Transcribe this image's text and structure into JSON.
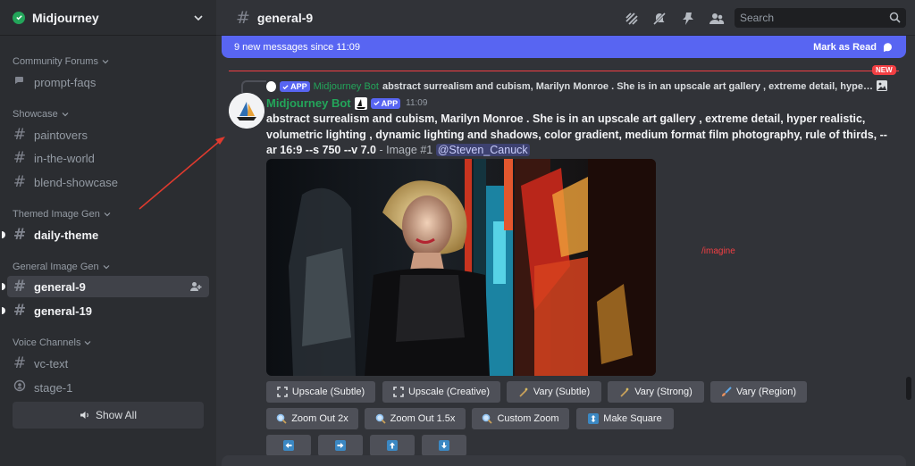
{
  "server": {
    "name": "Midjourney",
    "status_color": "#23a55a"
  },
  "sidebar": {
    "categories": [
      {
        "label": "Community Forums"
      },
      {
        "label": "Showcase"
      },
      {
        "label": "Themed Image Gen"
      },
      {
        "label": "General Image Gen"
      },
      {
        "label": "Voice Channels"
      }
    ],
    "channels": [
      {
        "label": "prompt-faqs",
        "icon": "forum-icon"
      },
      {
        "label": "paintovers",
        "icon": "hash-icon"
      },
      {
        "label": "in-the-world",
        "icon": "hash-icon"
      },
      {
        "label": "blend-showcase",
        "icon": "hash-icon"
      },
      {
        "label": "daily-theme",
        "icon": "hash-icon",
        "unread": true
      },
      {
        "label": "general-9",
        "icon": "hash-icon",
        "active": true
      },
      {
        "label": "general-19",
        "icon": "hash-icon",
        "unread": true
      },
      {
        "label": "vc-text",
        "icon": "hash-icon"
      },
      {
        "label": "stage-1",
        "icon": "stage-icon"
      }
    ],
    "show_all": "Show All"
  },
  "header": {
    "channel": "general-9",
    "search_placeholder": "Search"
  },
  "new_messages": {
    "text": "9 new messages since 11:09",
    "action": "Mark as Read",
    "new_tag": "NEW"
  },
  "reply": {
    "tag": "APP",
    "author": "Midjourney Bot",
    "text": "abstract surrealism and cubism, Marilyn Monroe . She is in an upscale art gallery , extreme detail, hyper realistic..."
  },
  "message": {
    "author": "Midjourney Bot",
    "tag": "APP",
    "time": "11:09",
    "prompt": "abstract surrealism and cubism, Marilyn Monroe . She is in an upscale art gallery , extreme detail, hyper realistic, volumetric lighting , dynamic lighting and shadows, color gradient, medium format film photography, rule of thirds, --ar 16:9 --s 750 --v 7.0",
    "suffix": " - Image #1 ",
    "mention": "@Steven_Canuck"
  },
  "annotation": {
    "text": "/imagine",
    "color": "#f23f43"
  },
  "buttons": {
    "row1": [
      "Upscale (Subtle)",
      "Upscale (Creative)",
      "Vary (Subtle)",
      "Vary (Strong)",
      "Vary (Region)"
    ],
    "row2": [
      "Zoom Out 2x",
      "Zoom Out 1.5x",
      "Custom Zoom",
      "Make Square"
    ],
    "row3_icons": [
      "arrow-left-icon",
      "arrow-right-icon",
      "arrow-up-icon",
      "arrow-down-icon"
    ]
  },
  "colors": {
    "accent": "#5865f2",
    "bot_name": "#23a55a",
    "alert": "#f23f43"
  }
}
